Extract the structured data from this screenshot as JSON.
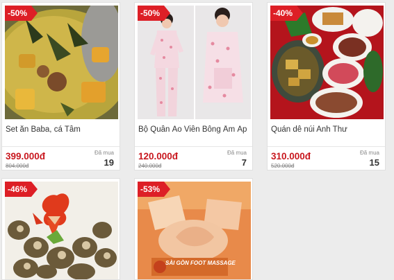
{
  "products": [
    {
      "discount": "-50%",
      "title": "Set ăn Baba, cá Tầm",
      "price": "399.000đ",
      "old_price": "804.000đ",
      "sold_label": "Đã mua",
      "sold_count": "19"
    },
    {
      "discount": "-50%",
      "title": "Bộ Quần Áo Viền Bông Ấm Áp",
      "price": "120.000đ",
      "old_price": "240.000đ",
      "sold_label": "Đã mua",
      "sold_count": "7"
    },
    {
      "discount": "-40%",
      "title": "Quán dê núi Anh Thư",
      "price": "310.000đ",
      "old_price": "520.000đ",
      "sold_label": "Đã mua",
      "sold_count": "15"
    },
    {
      "discount": "-46%"
    },
    {
      "discount": "-53%",
      "photo_text": "SÀI GÒN FOOT MASSAGE"
    }
  ],
  "colors": {
    "badge": "#dd1f26",
    "price": "#c8171e",
    "background": "#ececec"
  }
}
